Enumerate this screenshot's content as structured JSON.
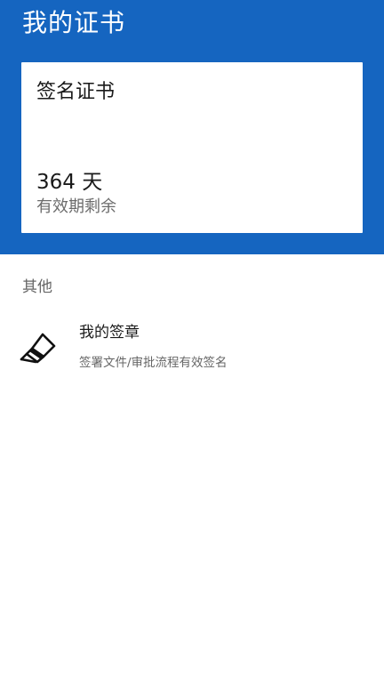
{
  "header": {
    "title": "我的证书"
  },
  "certificate_card": {
    "title": "签名证书",
    "days_remaining": "364 天",
    "days_label": "有效期剩余"
  },
  "other_section": {
    "label": "其他",
    "items": [
      {
        "icon": "seal-stamp-icon",
        "title": "我的签章",
        "subtitle": "签署文件/审批流程有效签名"
      }
    ]
  },
  "colors": {
    "header_background": "#1565c0",
    "card_background": "#ffffff",
    "page_background": "#ffffff"
  }
}
